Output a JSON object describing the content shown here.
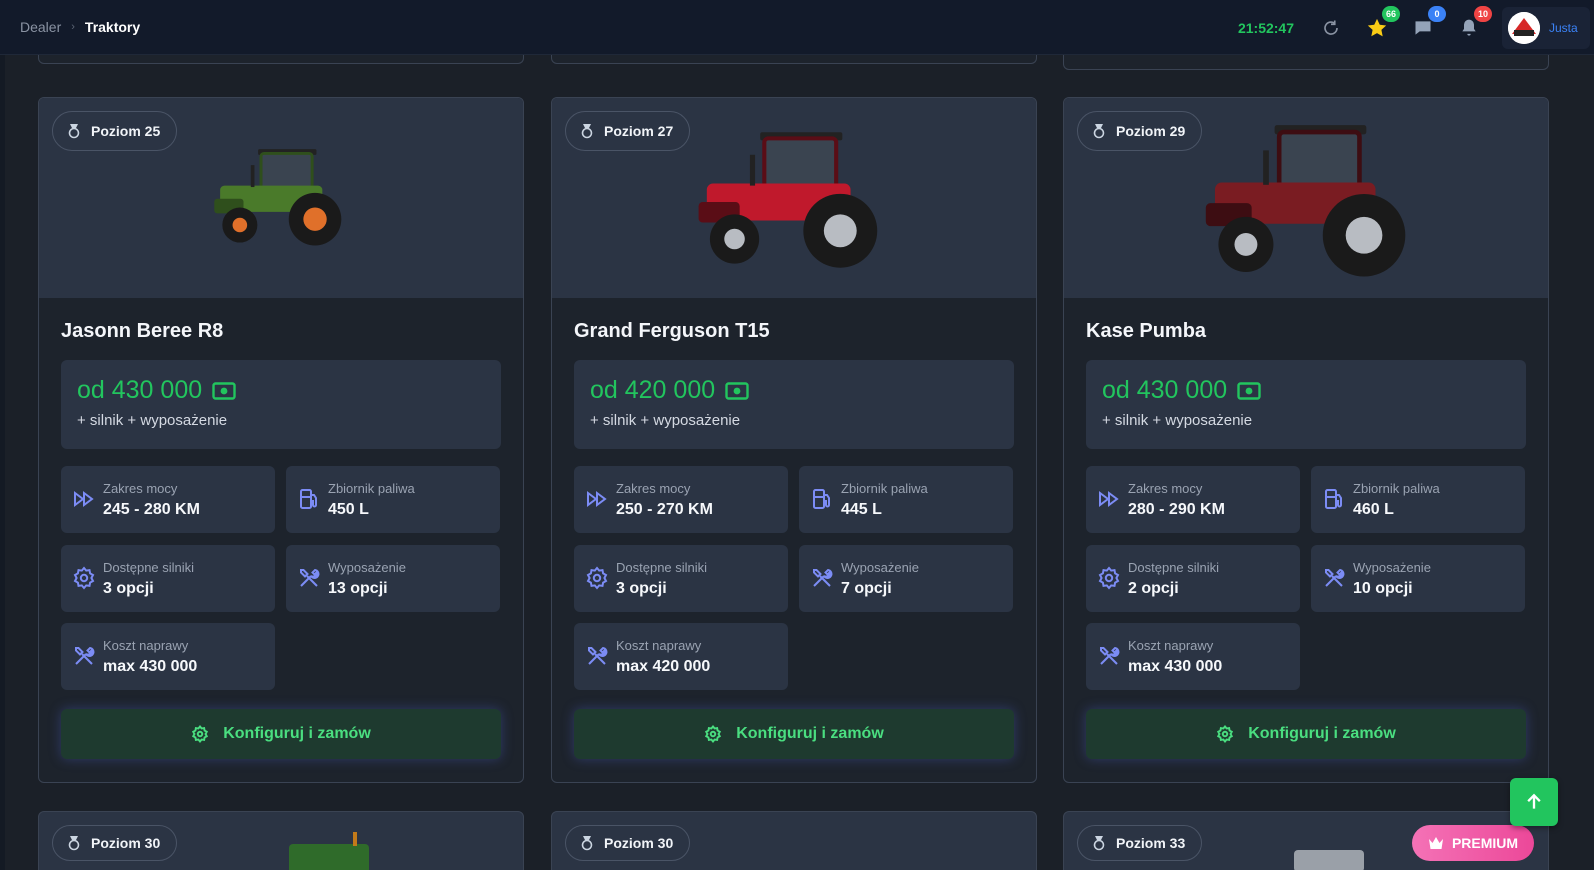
{
  "breadcrumb": {
    "root": "Dealer",
    "separator": "›",
    "current": "Traktory"
  },
  "header": {
    "clock": "21:52:47",
    "favorites_count": "66",
    "messages_count": "0",
    "notifications_count": "10",
    "username": "Justa"
  },
  "colors": {
    "accent_green": "#22c55e",
    "card_bg": "#2b3444",
    "page_bg": "#1b2028",
    "badge_green": "#22c55e",
    "badge_blue": "#3b82f6",
    "badge_red": "#ef4444",
    "premium_pink": "#ec4899"
  },
  "labels": {
    "price_sub": "+ silnik + wyposażenie",
    "power_range": "Zakres mocy",
    "fuel_tank": "Zbiornik paliwa",
    "engines": "Dostępne silniki",
    "equipment": "Wyposażenie",
    "repair_cost": "Koszt naprawy",
    "cta": "Konfiguruj i zamów"
  },
  "cards": [
    {
      "level": "Poziom 25",
      "name": "Jasonn Beree R8",
      "price": "od 430 000",
      "power": "245 - 280 KM",
      "fuel": "450 L",
      "engines": "3 opcji",
      "equipment": "13 opcji",
      "repair": "max 430 000",
      "color": "green"
    },
    {
      "level": "Poziom 27",
      "name": "Grand Ferguson T15",
      "price": "od 420 000",
      "power": "250 - 270 KM",
      "fuel": "445 L",
      "engines": "3 opcji",
      "equipment": "7 opcji",
      "repair": "max 420 000",
      "color": "red"
    },
    {
      "level": "Poziom 29",
      "name": "Kase Pumba",
      "price": "od 430 000",
      "power": "280 - 290 KM",
      "fuel": "460 L",
      "engines": "2 opcji",
      "equipment": "10 opcji",
      "repair": "max 430 000",
      "color": "darkred"
    }
  ],
  "next_row": [
    {
      "level": "Poziom 30"
    },
    {
      "level": "Poziom 30"
    },
    {
      "level": "Poziom 33",
      "premium": "PREMIUM"
    }
  ]
}
